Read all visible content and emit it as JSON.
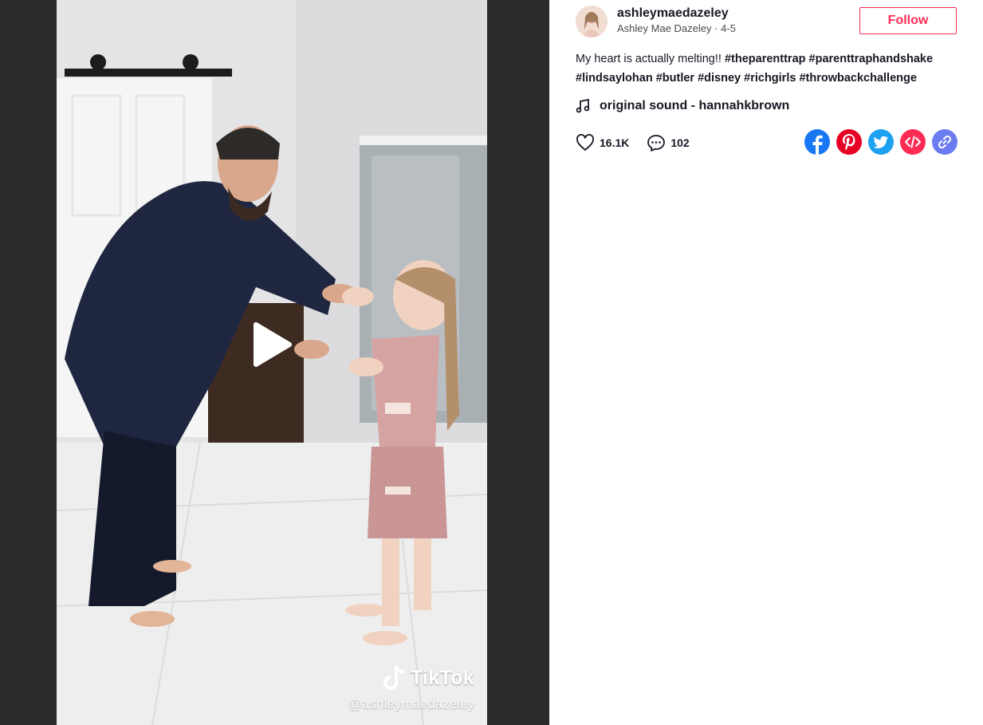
{
  "video": {
    "watermark_brand": "TikTok",
    "watermark_handle": "@ashleymaedazeley"
  },
  "author": {
    "handle": "ashleymaedazeley",
    "display_name": "Ashley Mae Dazeley",
    "date": "4-5",
    "separator": " · "
  },
  "follow_label": "Follow",
  "caption": {
    "text": "My heart is actually melting!! ",
    "hashtags": [
      "#theparenttrap",
      "#parenttraphandshake",
      "#lindsaylohan",
      "#butler",
      "#disney",
      "#richgirls",
      "#throwbackchallenge"
    ]
  },
  "music": {
    "title": "original sound - hannahkbrown"
  },
  "stats": {
    "likes": "16.1K",
    "comments": "102"
  },
  "share": [
    "facebook",
    "pinterest",
    "twitter",
    "embed",
    "copy-link"
  ],
  "colors": {
    "accent": "#fe2c55",
    "facebook": "#1877f2",
    "pinterest": "#e60023",
    "twitter": "#1da1f2",
    "embed": "#fe2c55",
    "link": "#6b7bf2"
  },
  "icons": {
    "music": "music-note-icon",
    "like": "heart-icon",
    "comment": "comment-icon",
    "play": "play-icon"
  }
}
